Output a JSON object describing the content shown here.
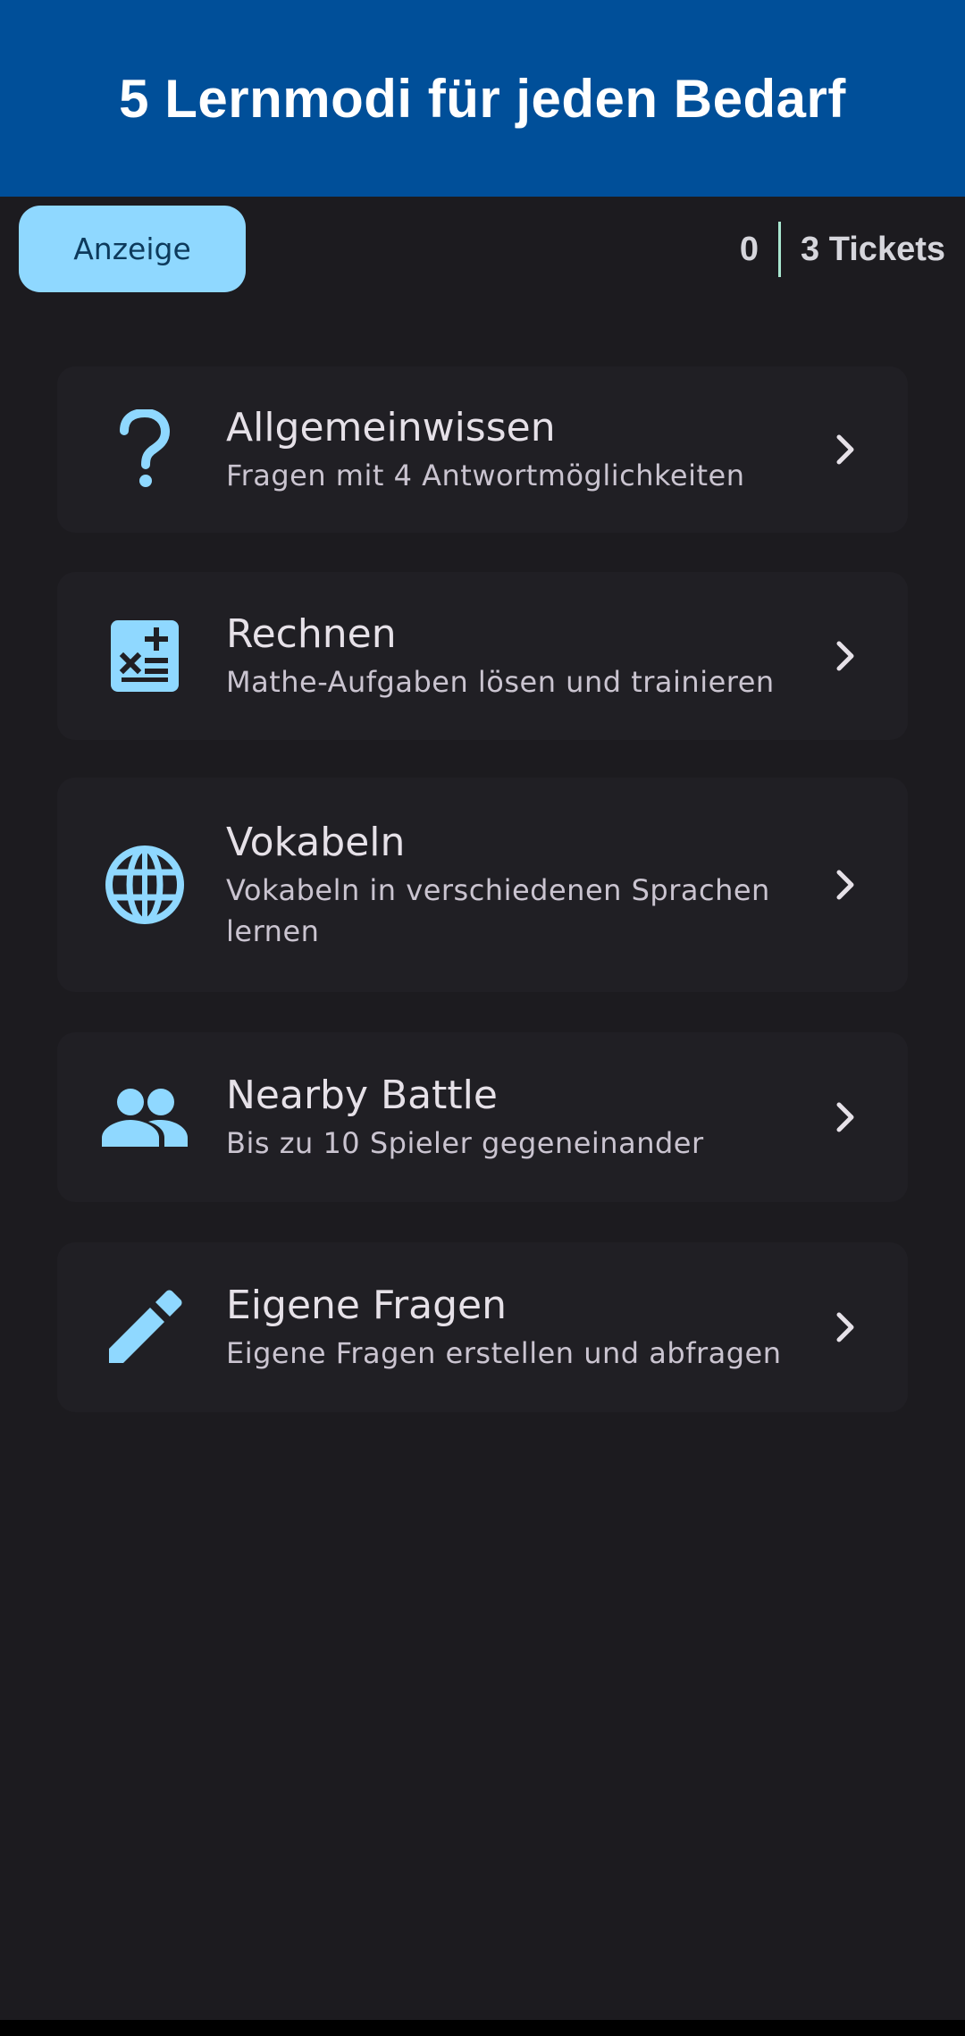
{
  "banner": {
    "title": "5 Lernmodi für jeden Bedarf"
  },
  "topbar": {
    "ad_button_label": "Anzeige",
    "count": "0",
    "tickets_label": "3 Tickets"
  },
  "modes": [
    {
      "title": "Allgemeinwissen",
      "subtitle": "Fragen mit 4 Antwortmöglichkeiten",
      "icon": "question-mark-icon"
    },
    {
      "title": "Rechnen",
      "subtitle": "Mathe-Aufgaben lösen und trainieren",
      "icon": "calculate-icon"
    },
    {
      "title": "Vokabeln",
      "subtitle": "Vokabeln in verschiedenen Sprachen lernen",
      "icon": "globe-icon"
    },
    {
      "title": "Nearby Battle",
      "subtitle": "Bis zu 10 Spieler gegeneinander",
      "icon": "people-icon"
    },
    {
      "title": "Eigene Fragen",
      "subtitle": "Eigene Fragen erstellen und abfragen",
      "icon": "pencil-icon"
    }
  ],
  "colors": {
    "banner_bg": "#004f99",
    "background": "#1c1b1f",
    "accent": "#8fd8ff",
    "card_bg": "#201f24"
  }
}
